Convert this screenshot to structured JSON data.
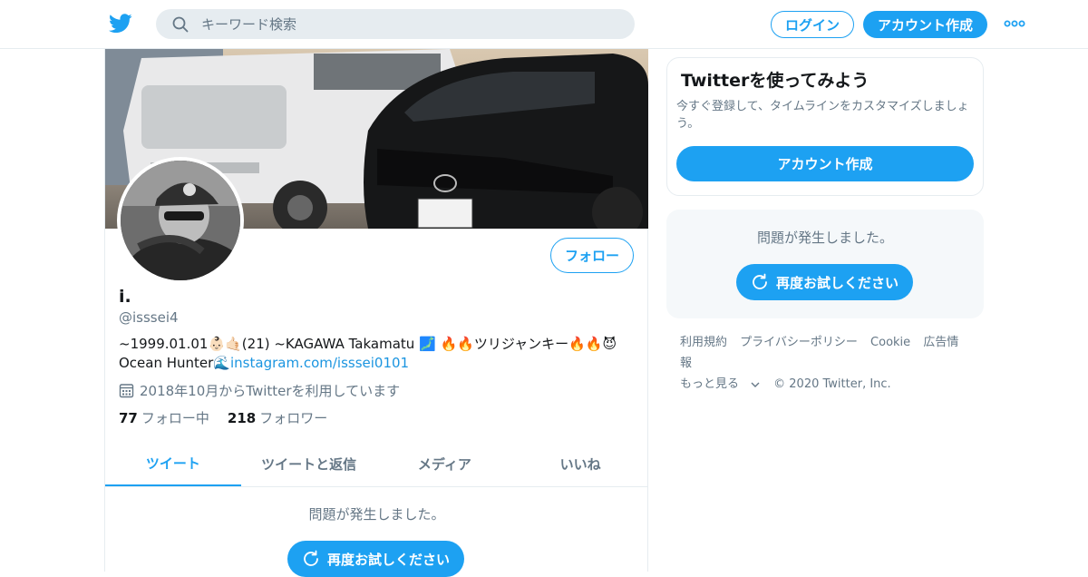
{
  "header": {
    "search_placeholder": "キーワード検索",
    "login_label": "ログイン",
    "signup_label": "アカウント作成",
    "more_icon": "more-dots-icon"
  },
  "profile": {
    "follow_label": "フォロー",
    "name": "i.",
    "handle": "@isssei4",
    "bio_line1": "~1999.01.01👶🏻🤙🏻(21) ~KAGAWA Takamatu 🗾 🔥🔥ツリジャンキー🔥🔥😈",
    "bio_line2_text": "Ocean Hunter🌊",
    "bio_link": "instagram.com/isssei0101",
    "joined": "2018年10月からTwitterを利用しています",
    "following_count": "77",
    "following_label": "フォロー中",
    "followers_count": "218",
    "followers_label": "フォロワー"
  },
  "tabs": [
    {
      "label": "ツイート",
      "active": true
    },
    {
      "label": "ツイートと返信",
      "active": false
    },
    {
      "label": "メディア",
      "active": false
    },
    {
      "label": "いいね",
      "active": false
    }
  ],
  "main_error": {
    "message": "問題が発生しました。",
    "retry_label": "再度お試しください"
  },
  "sidebar": {
    "card_title": "Twitterを使ってみよう",
    "card_text": "今すぐ登録して、タイムラインをカスタマイズしましょう。",
    "card_button": "アカウント作成",
    "error_message": "問題が発生しました。",
    "retry_label": "再度お試しください"
  },
  "footer": {
    "links": [
      "利用規約",
      "プライバシーポリシー",
      "Cookie",
      "広告情報"
    ],
    "more_label": "もっと見る",
    "copyright": "© 2020 Twitter, Inc."
  },
  "colors": {
    "accent": "#1da1f2",
    "border": "#e6ecf0",
    "muted": "#657786"
  }
}
